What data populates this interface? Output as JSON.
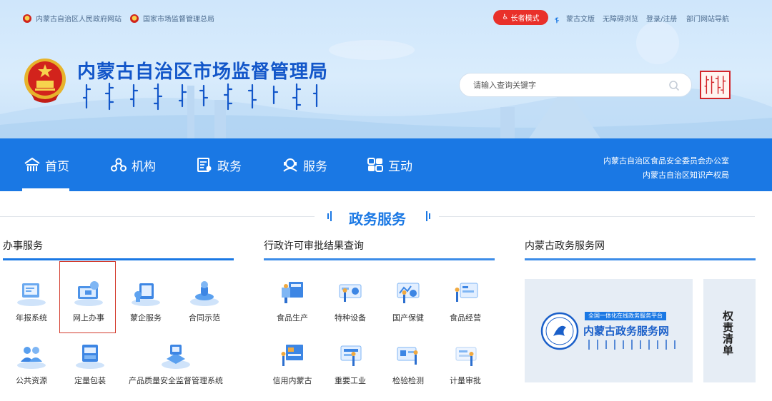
{
  "topbar": {
    "left_links": [
      "内蒙古自治区人民政府网站",
      "国家市场监督管理总局"
    ],
    "elder_mode": "长者模式",
    "right_links": [
      "蒙古文版",
      "无障碍浏览",
      "登录/注册",
      "部门网站导航"
    ]
  },
  "header": {
    "title": "内蒙古自治区市场监督管理局"
  },
  "search": {
    "placeholder": "请输入查询关键字"
  },
  "nav": {
    "items": [
      "首页",
      "机构",
      "政务",
      "服务",
      "互动"
    ],
    "active": "首页",
    "right_links": [
      "内蒙古自治区食品安全委员会办公室",
      "内蒙古自治区知识产权局"
    ]
  },
  "section": {
    "title": "政务服务"
  },
  "columns": {
    "banshi": {
      "title": "办事服务",
      "items": [
        "年报系统",
        "网上办事",
        "蒙企服务",
        "合同示范",
        "公共资源",
        "定量包装",
        "产品质量安全监督管理系统"
      ],
      "highlighted": "网上办事"
    },
    "xingzheng": {
      "title": "行政许可审批结果查询",
      "items": [
        "食品生产",
        "特种设备",
        "国产保健",
        "食品经营",
        "信用内蒙古",
        "重要工业",
        "检验检测",
        "计量审批"
      ]
    },
    "gov": {
      "title": "内蒙古政务服务网",
      "card_pill": "全国一体化在线政务服务平台",
      "card_title": "内蒙古政务服务网",
      "side_card": "权责清单"
    }
  },
  "colors": {
    "brand_blue": "#1a78e4",
    "title_blue": "#1256c9",
    "elder_red": "#e9302a",
    "highlight_red": "#d33a2c"
  },
  "icons": {
    "nav": [
      "home-icon",
      "org-icon",
      "affairs-icon",
      "service-icon",
      "interact-icon"
    ],
    "banshi": [
      "annual-report-icon",
      "online-affairs-icon",
      "enterprise-service-icon",
      "contract-icon",
      "public-resource-icon",
      "package-icon",
      "quality-system-icon"
    ],
    "xingzheng": [
      "food-production-icon",
      "special-equipment-icon",
      "health-product-icon",
      "food-business-icon",
      "credit-icon",
      "industry-icon",
      "inspection-icon",
      "measurement-icon"
    ]
  }
}
